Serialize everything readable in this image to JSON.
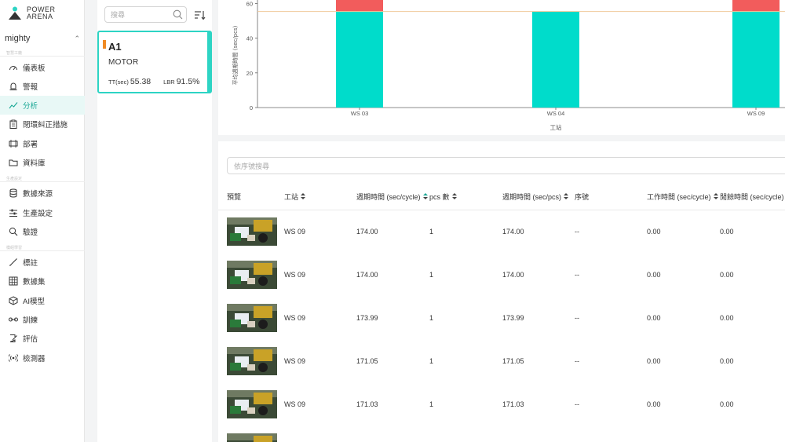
{
  "brand": {
    "line1": "POWER",
    "line2": "ARENA"
  },
  "workspace": {
    "name": "mighty"
  },
  "sidebar": {
    "sections": [
      "智慧工廠",
      "生產設定",
      "模組學習"
    ],
    "items": [
      {
        "label": "儀表板",
        "icon": "dashboard-icon"
      },
      {
        "label": "警報",
        "icon": "alarm-icon"
      },
      {
        "label": "分析",
        "icon": "analytics-icon",
        "active": true
      },
      {
        "label": "閉環糾正措施",
        "icon": "clipboard-icon"
      },
      {
        "label": "部署",
        "icon": "deploy-icon"
      },
      {
        "label": "資料庫",
        "icon": "folder-icon"
      },
      {
        "label": "數據來源",
        "icon": "database-icon"
      },
      {
        "label": "生產設定",
        "icon": "settings-sliders-icon"
      },
      {
        "label": "驗證",
        "icon": "search-icon"
      },
      {
        "label": "標註",
        "icon": "brush-icon"
      },
      {
        "label": "數據集",
        "icon": "grid-icon"
      },
      {
        "label": "AI模型",
        "icon": "cube-icon"
      },
      {
        "label": "訓練",
        "icon": "dumbbell-icon"
      },
      {
        "label": "評估",
        "icon": "edit-doc-icon"
      },
      {
        "label": "檢測器",
        "icon": "sensor-icon"
      }
    ]
  },
  "stations": {
    "search_placeholder": "搜尋",
    "card": {
      "title": "A1",
      "subtitle": "MOTOR",
      "tt_label": "TT(sec)",
      "tt_value": "55.38",
      "lbr_label": "LBR",
      "lbr_value": "91.5%"
    }
  },
  "chart_data": {
    "type": "bar",
    "stacked": true,
    "categories": [
      "WS 03",
      "WS 04",
      "WS 09"
    ],
    "series": [
      {
        "color": "#00dccb",
        "values": [
          55.4,
          55.4,
          55.4
        ]
      },
      {
        "color": "#f25c5c",
        "values": [
          22,
          0,
          30
        ]
      }
    ],
    "reference_line": {
      "value": 55.38,
      "color": "#f0c89a"
    },
    "ylabel": "平均週期時間 (sec/pcs)",
    "xlabel": "工站",
    "yticks": [
      0,
      20,
      40,
      60
    ],
    "grid": false
  },
  "table": {
    "search_placeholder": "依序號搜尋",
    "columns": [
      "預覽",
      "工站",
      "週期時間 (sec/cycle)",
      "pcs 數",
      "週期時間 (sec/pcs)",
      "序號",
      "工作時間 (sec/cycle)",
      "閒餘時間 (sec/cycle)"
    ],
    "sortable": [
      false,
      true,
      true,
      true,
      true,
      false,
      true,
      true
    ],
    "rows": [
      {
        "station": "WS 09",
        "cycle": "174.00",
        "pcs": "1",
        "per_pcs": "174.00",
        "serial": "--",
        "work": "0.00",
        "idle": "0.00"
      },
      {
        "station": "WS 09",
        "cycle": "174.00",
        "pcs": "1",
        "per_pcs": "174.00",
        "serial": "--",
        "work": "0.00",
        "idle": "0.00"
      },
      {
        "station": "WS 09",
        "cycle": "173.99",
        "pcs": "1",
        "per_pcs": "173.99",
        "serial": "--",
        "work": "0.00",
        "idle": "0.00"
      },
      {
        "station": "WS 09",
        "cycle": "171.05",
        "pcs": "1",
        "per_pcs": "171.05",
        "serial": "--",
        "work": "0.00",
        "idle": "0.00"
      },
      {
        "station": "WS 09",
        "cycle": "171.03",
        "pcs": "1",
        "per_pcs": "171.03",
        "serial": "--",
        "work": "0.00",
        "idle": "0.00"
      }
    ]
  }
}
